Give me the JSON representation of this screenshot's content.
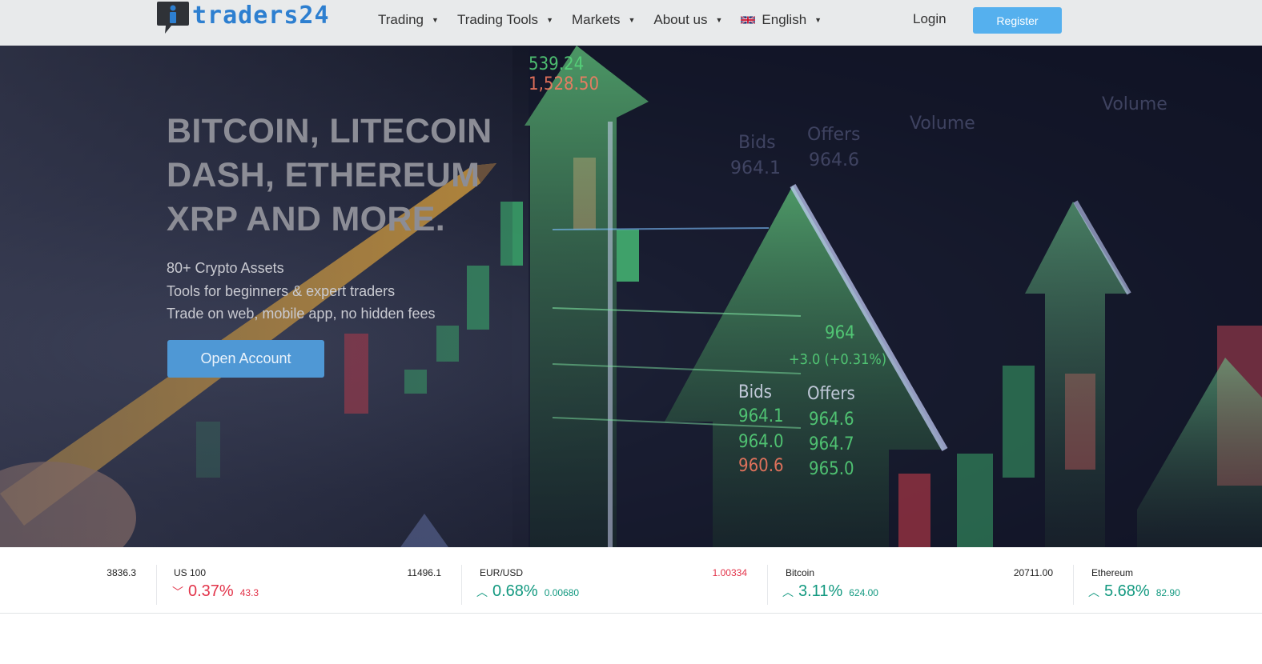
{
  "brand": {
    "name": "traders24"
  },
  "nav": {
    "items": [
      {
        "label": "Trading"
      },
      {
        "label": "Trading Tools"
      },
      {
        "label": "Markets"
      },
      {
        "label": "About us"
      },
      {
        "label": "English",
        "flag": "uk-flag-icon"
      }
    ],
    "login": "Login",
    "register": "Register"
  },
  "hero": {
    "headline": [
      "BITCOIN, LITECOIN",
      "DASH, ETHEREUM",
      "XRP AND MORE."
    ],
    "features": [
      "80+ Crypto Assets",
      "Tools for beginners & expert traders",
      "Trade on web, mobile app, no hidden fees"
    ],
    "cta": "Open Account",
    "background": "trading-chart-arrows-image"
  },
  "ticker": {
    "leading_price": "3836.3",
    "items": [
      {
        "name": "US 100",
        "price": "11496.1",
        "price_color": "#222222",
        "pct": "0.37%",
        "abs": "43.3",
        "direction": "down"
      },
      {
        "name": "EUR/USD",
        "price": "1.00334",
        "price_color": "#e2344a",
        "pct": "0.68%",
        "abs": "0.00680",
        "direction": "up"
      },
      {
        "name": "Bitcoin",
        "price": "20711.00",
        "price_color": "#222222",
        "pct": "3.11%",
        "abs": "624.00",
        "direction": "up"
      },
      {
        "name": "Ethereum",
        "price": "",
        "price_color": "#222222",
        "pct": "5.68%",
        "abs": "82.90",
        "direction": "up"
      }
    ]
  },
  "colors": {
    "up": "#139980",
    "down": "#e2344a",
    "accent": "#55b0ee",
    "cta": "#4f98d5"
  }
}
